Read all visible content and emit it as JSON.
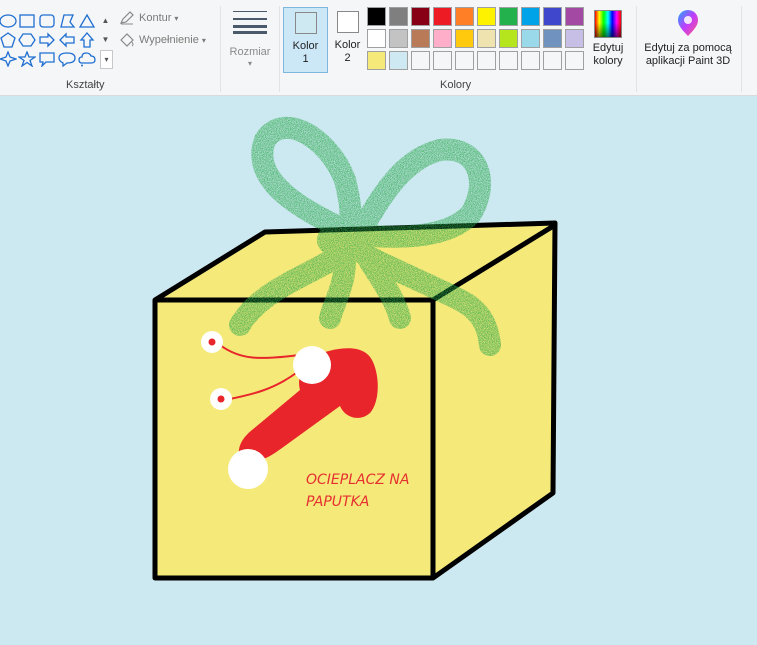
{
  "ribbon": {
    "shapes_group_label": "Kształty",
    "outline_label": "Kontur",
    "fill_label": "Wypełnienie",
    "size_label": "Rozmiar",
    "color1_label": "Kolor",
    "color1_num": "1",
    "color2_label": "Kolor",
    "color2_num": "2",
    "edit_colors_line1": "Edytuj",
    "edit_colors_line2": "kolory",
    "paint3d_line1": "Edytuj za pomocą",
    "paint3d_line2": "aplikacji Paint 3D",
    "colors_group_label": "Kolory",
    "color1_value": "#cfe9f2",
    "color2_value": "#ffffff",
    "palette_row1": [
      "#000000",
      "#7f7f7f",
      "#880015",
      "#ed1c24",
      "#ff7f27",
      "#fff200",
      "#22b14c",
      "#00a2e8",
      "#3f48cc",
      "#a349a4"
    ],
    "palette_row2": [
      "#ffffff",
      "#c3c3c3",
      "#b97a57",
      "#ffaec9",
      "#ffc90e",
      "#efe4b0",
      "#b5e61d",
      "#99d9ea",
      "#7092be",
      "#c8bfe7"
    ],
    "palette_row3": [
      "#f5e97a",
      "#cfe9f2",
      "#f5f6f7",
      "#f5f6f7",
      "#f5f6f7",
      "#f5f6f7",
      "#f5f6f7",
      "#f5f6f7",
      "#f5f6f7",
      "#f5f6f7"
    ]
  },
  "canvas": {
    "background": "#cce8f0",
    "note_line1": "OCIEPLACZ NA",
    "note_line2": "PAPUTKA",
    "box_color": "#f5e97a",
    "bow_color": "#2aa84a",
    "slipper_color": "#e8252a"
  }
}
